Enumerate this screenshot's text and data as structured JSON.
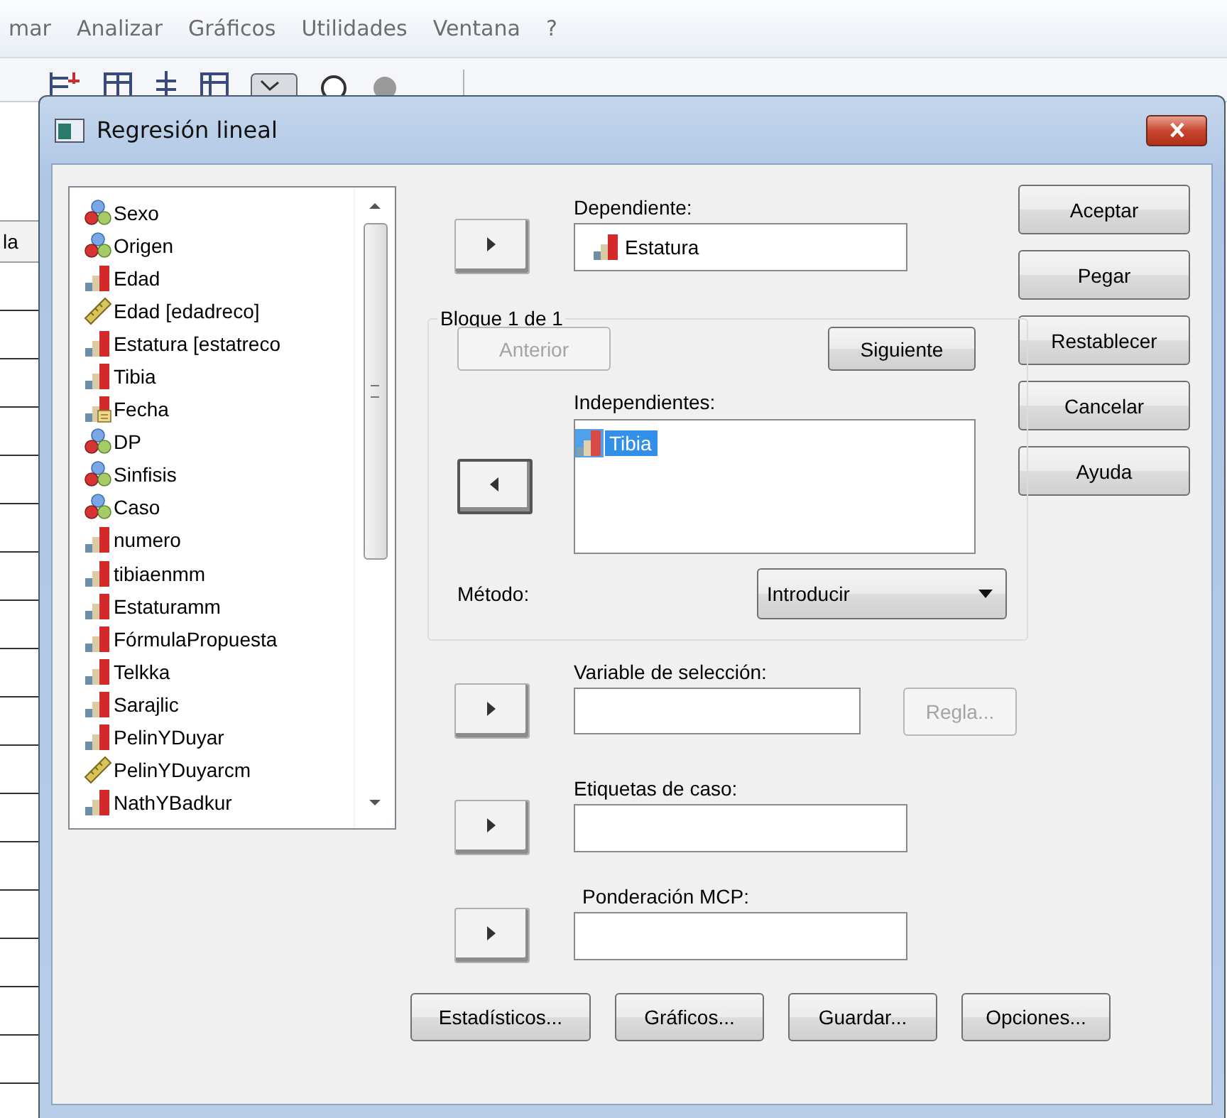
{
  "menu": [
    {
      "label": "mar"
    },
    {
      "label": "Analizar"
    },
    {
      "label": "Gráficos"
    },
    {
      "label": "Utilidades"
    },
    {
      "label": "Ventana"
    },
    {
      "label": "?"
    }
  ],
  "sheet": {
    "header": "la"
  },
  "dialog": {
    "title": "Regresión lineal",
    "variables": [
      {
        "name": "Sexo",
        "kind": "nominal"
      },
      {
        "name": "Origen",
        "kind": "nominal"
      },
      {
        "name": "Edad",
        "kind": "scale"
      },
      {
        "name": "Edad [edadreco]",
        "kind": "ruler"
      },
      {
        "name": "Estatura [estatreco",
        "kind": "scale"
      },
      {
        "name": "Tibia",
        "kind": "scale"
      },
      {
        "name": "Fecha",
        "kind": "date"
      },
      {
        "name": "DP",
        "kind": "nominal"
      },
      {
        "name": "Sinfisis",
        "kind": "nominal"
      },
      {
        "name": "Caso",
        "kind": "nominal"
      },
      {
        "name": "numero",
        "kind": "scale"
      },
      {
        "name": "tibiaenmm",
        "kind": "scale"
      },
      {
        "name": "Estaturamm",
        "kind": "scale"
      },
      {
        "name": "FórmulaPropuesta",
        "kind": "scale"
      },
      {
        "name": "Telkka",
        "kind": "scale"
      },
      {
        "name": "Sarajlic",
        "kind": "scale"
      },
      {
        "name": "PelinYDuyar",
        "kind": "scale"
      },
      {
        "name": "PelinYDuyarcm",
        "kind": "ruler"
      },
      {
        "name": "NathYBadkur",
        "kind": "scale"
      }
    ],
    "dependent": {
      "label": "Dependiente:",
      "value": "Estatura",
      "kind": "scale"
    },
    "block": {
      "label": "Bloque 1 de 1",
      "previous": {
        "label": "Anterior",
        "disabled": true
      },
      "next": {
        "label": "Siguiente",
        "disabled": false
      }
    },
    "independents": {
      "label": "Independientes:",
      "items": [
        {
          "name": "Tibia",
          "kind": "scale",
          "selected": true
        }
      ]
    },
    "method": {
      "label": "Método:",
      "value": "Introducir"
    },
    "selection": {
      "label": "Variable de selección:",
      "rule": {
        "label": "Regla...",
        "disabled": true
      }
    },
    "case_labels": {
      "label": "Etiquetas de caso:"
    },
    "wls": {
      "label": "Ponderación MCP:"
    },
    "side_buttons": [
      {
        "label": "Aceptar"
      },
      {
        "label": "Pegar"
      },
      {
        "label": "Restablecer"
      },
      {
        "label": "Cancelar"
      },
      {
        "label": "Ayuda"
      }
    ],
    "bottom_buttons": [
      {
        "label": "Estadísticos..."
      },
      {
        "label": "Gráficos..."
      },
      {
        "label": "Guardar..."
      },
      {
        "label": "Opciones..."
      }
    ]
  }
}
